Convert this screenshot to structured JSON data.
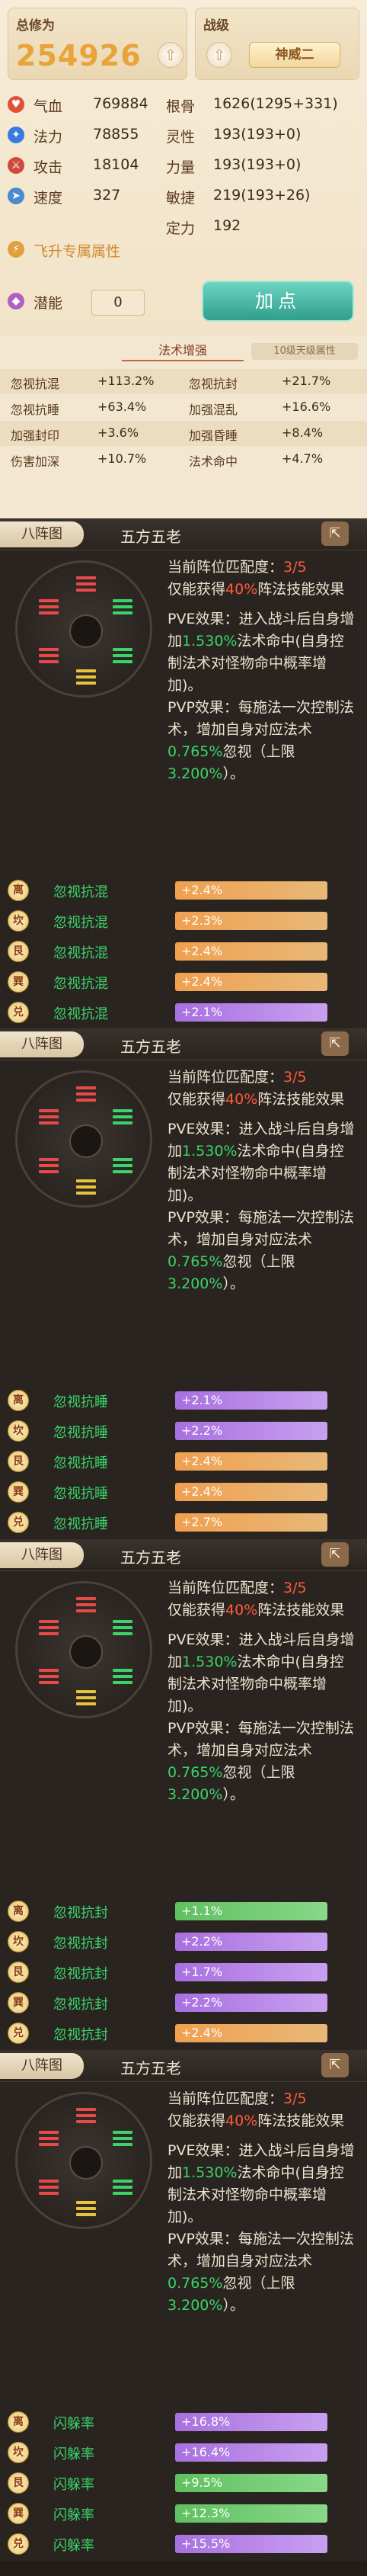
{
  "header": {
    "total_label": "总修为",
    "total_value": "254926",
    "rank_label": "战级",
    "rank_value": "神威二"
  },
  "stats_left": [
    {
      "key": "气血",
      "value": "769884",
      "icon": "heart-icon",
      "color": "#e0503a"
    },
    {
      "key": "法力",
      "value": "78855",
      "icon": "mana-icon",
      "color": "#3a7ae0"
    },
    {
      "key": "攻击",
      "value": "18104",
      "icon": "sword-icon",
      "color": "#d04a3a"
    },
    {
      "key": "速度",
      "value": "327",
      "icon": "boot-icon",
      "color": "#4a8ad0"
    }
  ],
  "stats_right": [
    {
      "key": "根骨",
      "value": "1626(1295+331)"
    },
    {
      "key": "灵性",
      "value": "193(193+0)"
    },
    {
      "key": "力量",
      "value": "193(193+0)"
    },
    {
      "key": "敏捷",
      "value": "219(193+26)"
    },
    {
      "key": "定力",
      "value": "192"
    }
  ],
  "fly_attr": "飞升专属属性",
  "potential": {
    "label": "潜能",
    "value": "0"
  },
  "add_button": "加点",
  "magic": {
    "tab": "法术增强",
    "side_tab": "10级天级属性",
    "rows": [
      [
        "忽视抗混",
        "+113.2%",
        "忽视抗封",
        "+21.7%"
      ],
      [
        "忽视抗睡",
        "+63.4%",
        "加强混乱",
        "+16.6%"
      ],
      [
        "加强封印",
        "+3.6%",
        "加强昏睡",
        "+8.4%"
      ],
      [
        "伤害加深",
        "+10.7%",
        "法术命中",
        "+4.7%"
      ]
    ]
  },
  "sections": [
    {
      "tab": "八阵图",
      "name": "五方五老",
      "match_label": "当前阵位匹配度：",
      "match_value": "3/5",
      "gain_pre": "仅能获得",
      "gain_pct": "40%",
      "gain_post": "阵法技能效果",
      "pve_pre": "PVE效果：进入战斗后自身增加",
      "pve_val": "1.530%",
      "pve_post": "法术命中(自身控制法术对怪物命中概率增加)。",
      "pvp_pre": "PVP效果：每施法一次控制法术，增加自身对应法术",
      "pvp_val": "0.765%",
      "pvp_mid": "忽视（上限",
      "pvp_cap": "3.200%",
      "pvp_post": "）。",
      "bonuses": [
        {
          "badge": "离",
          "name": "忽视抗混",
          "value": "+2.4%",
          "kind": "o"
        },
        {
          "badge": "坎",
          "name": "忽视抗混",
          "value": "+2.3%",
          "kind": "o"
        },
        {
          "badge": "艮",
          "name": "忽视抗混",
          "value": "+2.4%",
          "kind": "o"
        },
        {
          "badge": "巽",
          "name": "忽视抗混",
          "value": "+2.4%",
          "kind": "o"
        },
        {
          "badge": "兑",
          "name": "忽视抗混",
          "value": "+2.1%",
          "kind": "p"
        }
      ]
    },
    {
      "tab": "八阵图",
      "name": "五方五老",
      "match_label": "当前阵位匹配度：",
      "match_value": "3/5",
      "gain_pre": "仅能获得",
      "gain_pct": "40%",
      "gain_post": "阵法技能效果",
      "pve_pre": "PVE效果：进入战斗后自身增加",
      "pve_val": "1.530%",
      "pve_post": "法术命中(自身控制法术对怪物命中概率增加)。",
      "pvp_pre": "PVP效果：每施法一次控制法术，增加自身对应法术",
      "pvp_val": "0.765%",
      "pvp_mid": "忽视（上限",
      "pvp_cap": "3.200%",
      "pvp_post": "）。",
      "bonuses": [
        {
          "badge": "离",
          "name": "忽视抗睡",
          "value": "+2.1%",
          "kind": "p"
        },
        {
          "badge": "坎",
          "name": "忽视抗睡",
          "value": "+2.2%",
          "kind": "p"
        },
        {
          "badge": "艮",
          "name": "忽视抗睡",
          "value": "+2.4%",
          "kind": "o"
        },
        {
          "badge": "巽",
          "name": "忽视抗睡",
          "value": "+2.4%",
          "kind": "o"
        },
        {
          "badge": "兑",
          "name": "忽视抗睡",
          "value": "+2.7%",
          "kind": "o"
        }
      ]
    },
    {
      "tab": "八阵图",
      "name": "五方五老",
      "match_label": "当前阵位匹配度：",
      "match_value": "3/5",
      "gain_pre": "仅能获得",
      "gain_pct": "40%",
      "gain_post": "阵法技能效果",
      "pve_pre": "PVE效果：进入战斗后自身增加",
      "pve_val": "1.530%",
      "pve_post": "法术命中(自身控制法术对怪物命中概率增加)。",
      "pvp_pre": "PVP效果：每施法一次控制法术，增加自身对应法术",
      "pvp_val": "0.765%",
      "pvp_mid": "忽视（上限",
      "pvp_cap": "3.200%",
      "pvp_post": "）。",
      "bonuses": [
        {
          "badge": "离",
          "name": "忽视抗封",
          "value": "+1.1%",
          "kind": "g"
        },
        {
          "badge": "坎",
          "name": "忽视抗封",
          "value": "+2.2%",
          "kind": "p"
        },
        {
          "badge": "艮",
          "name": "忽视抗封",
          "value": "+1.7%",
          "kind": "p"
        },
        {
          "badge": "巽",
          "name": "忽视抗封",
          "value": "+2.2%",
          "kind": "p"
        },
        {
          "badge": "兑",
          "name": "忽视抗封",
          "value": "+2.4%",
          "kind": "o"
        }
      ]
    },
    {
      "tab": "八阵图",
      "name": "五方五老",
      "match_label": "当前阵位匹配度：",
      "match_value": "3/5",
      "gain_pre": "仅能获得",
      "gain_pct": "40%",
      "gain_post": "阵法技能效果",
      "pve_pre": "PVE效果：进入战斗后自身增加",
      "pve_val": "1.530%",
      "pve_post": "法术命中(自身控制法术对怪物命中概率增加)。",
      "pvp_pre": "PVP效果：每施法一次控制法术，增加自身对应法术",
      "pvp_val": "0.765%",
      "pvp_mid": "忽视（上限",
      "pvp_cap": "3.200%",
      "pvp_post": "）。",
      "bonuses": [
        {
          "badge": "离",
          "name": "闪躲率",
          "value": "+16.8%",
          "kind": "p"
        },
        {
          "badge": "坎",
          "name": "闪躲率",
          "value": "+16.4%",
          "kind": "p"
        },
        {
          "badge": "艮",
          "name": "闪躲率",
          "value": "+9.5%",
          "kind": "g"
        },
        {
          "badge": "巽",
          "name": "闪躲率",
          "value": "+12.3%",
          "kind": "g"
        },
        {
          "badge": "兑",
          "name": "闪躲率",
          "value": "+15.5%",
          "kind": "p"
        }
      ]
    }
  ]
}
